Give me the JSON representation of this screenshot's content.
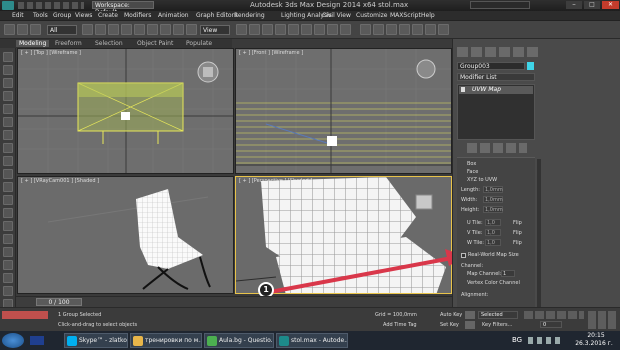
{
  "window": {
    "title": "Autodesk 3ds Max Design 2014 x64   stol.max",
    "workspace": "Workspace: Default"
  },
  "menu": [
    "Edit",
    "Tools",
    "Group",
    "Views",
    "Create",
    "Modifiers",
    "Animation",
    "Graph Editors",
    "Rendering",
    "Lighting Analysis",
    "Civil View",
    "Customize",
    "MAXScript",
    "Help"
  ],
  "toolbar": {
    "selection_filter": "All",
    "view_dropdown": "View"
  },
  "ribbon_tabs": [
    "Modeling",
    "Freeform",
    "Selection",
    "Object Paint",
    "Populate"
  ],
  "viewports": {
    "top": "[ + ] [Top ] [Wireframe ]",
    "front": "[ + ] [Front ] [Wireframe ]",
    "camera": "[ + ] [VRayCam001 ] [Shaded ]",
    "persp": "[ + ] [Perspective ] [Shaded ]"
  },
  "command_panel": {
    "object_name": "Group003",
    "modifier_list": "Modifier List",
    "modifier": "UVW Map",
    "labels": {
      "length": "Length:",
      "width": "Width:",
      "height": "Height:",
      "utile": "U Tile:",
      "vtile": "V Tile:",
      "wtile": "W Tile:",
      "flip": "Flip",
      "realworld": "Real-World Map Size",
      "channel": "Channel:",
      "mapchannel": "Map Channel:",
      "vertexcolor": "Vertex Color Channel",
      "alignment": "Alignment:"
    },
    "values": {
      "length": "1,0mm",
      "width": "1,0mm",
      "height": "1,0mm",
      "utile": "1,0",
      "vtile": "1,0",
      "wtile": "1,0",
      "mapchannel": "1"
    },
    "radios": [
      "Box",
      "Face",
      "XYZ to UVW"
    ]
  },
  "annotation": {
    "number": "1"
  },
  "timeline": {
    "frame": "0 / 100"
  },
  "status": {
    "selection": "1 Group Selected",
    "prompt": "Click-and-drag to select objects",
    "grid": "Grid = 100,0mm",
    "add_time_tag": "Add Time Tag",
    "autokey": "Auto Key",
    "selected": "Selected",
    "setkey": "Set Key",
    "keyfilters": "Key Filters...",
    "frame_field": "0"
  },
  "taskbar": {
    "items": [
      {
        "label": "Skype™ - zlatkov...",
        "color": "#00aff0"
      },
      {
        "label": "тренировки по м...",
        "color": "#e8b64a"
      },
      {
        "label": "Aula.bg - Questio...",
        "color": "#4caf50"
      },
      {
        "label": "stol.max - Autode...",
        "color": "#1d8a8a"
      }
    ],
    "lang": "BG",
    "time": "20:15",
    "date": "26.3.2016 г."
  },
  "colors": {
    "selection_yellow": "#e8e85a",
    "arrow_red": "#d9374a",
    "ui_bg": "#3a3a3a"
  }
}
